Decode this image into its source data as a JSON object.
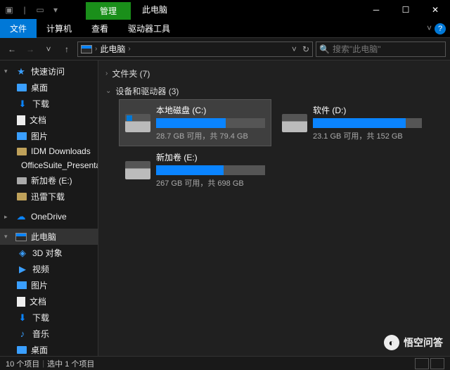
{
  "window": {
    "context_tab": "管理",
    "title": "此电脑"
  },
  "ribbon": {
    "file": "文件",
    "tabs": [
      "计算机",
      "查看"
    ],
    "context_tab": "驱动器工具"
  },
  "nav": {
    "crumb": "此电脑",
    "search_placeholder": "搜索\"此电脑\""
  },
  "sidebar": {
    "quick_access": "快速访问",
    "quick_items": [
      {
        "label": "桌面",
        "icon": "folder blue"
      },
      {
        "label": "下载",
        "icon": "arrow-down"
      },
      {
        "label": "文档",
        "icon": "doc"
      },
      {
        "label": "图片",
        "icon": "pic"
      },
      {
        "label": "IDM Downloads",
        "icon": "folder"
      },
      {
        "label": "OfficeSuite_Presentations",
        "icon": "folder"
      },
      {
        "label": "新加卷 (E:)",
        "icon": "drive"
      },
      {
        "label": "迅雷下载",
        "icon": "folder"
      }
    ],
    "onedrive": "OneDrive",
    "this_pc": "此电脑",
    "pc_items": [
      {
        "label": "3D 对象",
        "icon": "threed"
      },
      {
        "label": "视频",
        "icon": "vid"
      },
      {
        "label": "图片",
        "icon": "pic"
      },
      {
        "label": "文档",
        "icon": "doc"
      },
      {
        "label": "下载",
        "icon": "arrow-down"
      },
      {
        "label": "音乐",
        "icon": "note"
      },
      {
        "label": "桌面",
        "icon": "folder blue"
      }
    ]
  },
  "content": {
    "folders_header": "文件夹 (7)",
    "drives_header": "设备和驱动器 (3)",
    "drives": [
      {
        "name": "本地磁盘 (C:)",
        "text": "28.7 GB 可用，共 79.4 GB",
        "fill": 64,
        "win": true,
        "selected": true
      },
      {
        "name": "软件 (D:)",
        "text": "23.1 GB 可用，共 152 GB",
        "fill": 85,
        "win": false,
        "selected": false
      },
      {
        "name": "新加卷 (E:)",
        "text": "267 GB 可用，共 698 GB",
        "fill": 62,
        "win": false,
        "selected": false
      }
    ]
  },
  "statusbar": {
    "count": "10 个项目",
    "selected": "选中 1 个项目"
  },
  "watermark": "悟空问答"
}
